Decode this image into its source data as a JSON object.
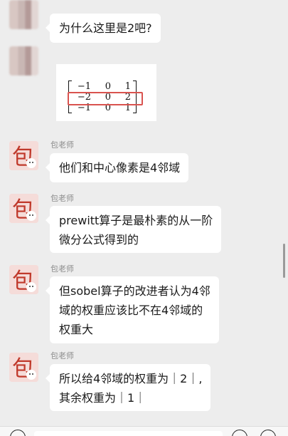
{
  "messages": [
    {
      "sender": "",
      "text_lines": [
        "为什么这里是2吧?"
      ]
    },
    {
      "sender": "",
      "matrix": [
        [
          "−1",
          "0",
          "1"
        ],
        [
          "−2",
          "0",
          "2"
        ],
        [
          "−1",
          "0",
          "1"
        ]
      ]
    },
    {
      "sender": "包老师",
      "text_lines": [
        "他们和中心像素是4邻域"
      ]
    },
    {
      "sender": "包老师",
      "text_lines": [
        "prewitt算子是最朴素的从一阶",
        "微分公式得到的"
      ]
    },
    {
      "sender": "包老师",
      "text_lines": [
        "但sobel算子的改进者认为4邻",
        "域的权重应该比不在4邻域的",
        "权重大"
      ]
    },
    {
      "sender": "包老师",
      "text_lines": [
        "所以给4邻域的权重为｜2｜,",
        "其余权重为｜1｜"
      ]
    }
  ],
  "avatar_glyph": "包",
  "colors": {
    "background": "#ededed",
    "bubble": "#ffffff",
    "highlight": "#d9534f",
    "avatar_bg": "#f5dcd9",
    "avatar_glyph": "#c0392b"
  }
}
